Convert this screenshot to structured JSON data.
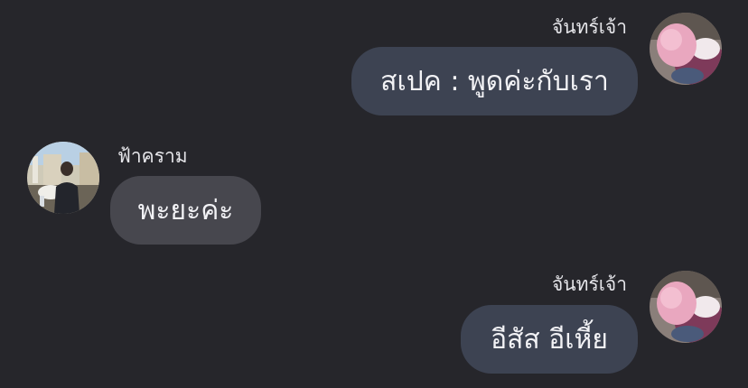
{
  "messages": [
    {
      "sender": "จันทร์เจ้า",
      "text": "สเปค : พูดค่ะกับเรา",
      "direction": "outgoing",
      "avatar": "pink-hair-avatar"
    },
    {
      "sender": "ฟ้าคราม",
      "text": "พะยะค่ะ",
      "direction": "incoming",
      "avatar": "cafe-photo-avatar"
    },
    {
      "sender": "จันทร์เจ้า",
      "text": "อีสัส อีเหี้ย",
      "direction": "outgoing",
      "avatar": "pink-hair-avatar"
    }
  ],
  "colors": {
    "background": "#26262b",
    "outgoing_bubble": "#3d4352",
    "incoming_bubble": "#47474e",
    "text": "#f2f2f5"
  }
}
